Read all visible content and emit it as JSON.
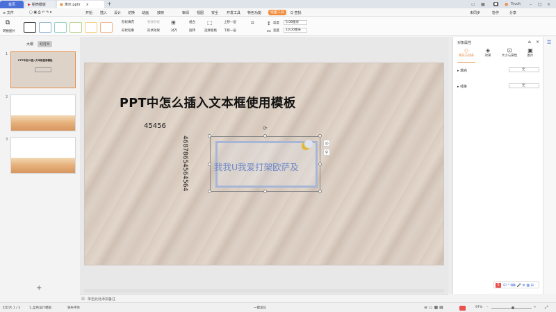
{
  "tabs": {
    "home": "首页",
    "t1": "稻壳模板",
    "t2": "演示.pptx",
    "add": "+"
  },
  "titlebar_right": {
    "workspace": "工作台",
    "user": "Tsvolt"
  },
  "menu": {
    "file": "≡ 文件",
    "items": [
      "开始",
      "插入",
      "设计",
      "切换",
      "动画",
      "放映",
      "审阅",
      "视图",
      "安全",
      "开发工具",
      "特色功能"
    ],
    "active": "绘图工具",
    "search": "Q 查找",
    "right": [
      "未同步",
      "协作",
      "分享"
    ]
  },
  "ribbon": {
    "shape_fill": "形状填充",
    "shape_outline": "形状轮廓",
    "shape_effect": "形状效果",
    "change_shape": "更改形状",
    "arrange": "对齐",
    "rotate": "旋转",
    "select_pane": "选择窗格",
    "up_layer": "上移一层",
    "down_layer": "下移一层",
    "group": "组合",
    "height_label": "高度",
    "height_value": "5.08厘米",
    "width_label": "宽度",
    "width_value": "10.00厘米",
    "convert": "转换图片"
  },
  "left": {
    "tab_outline": "大纲",
    "tab_slides": "幻灯片",
    "slide_numbers": [
      "1",
      "2",
      "3"
    ],
    "thumb1_title": "PPT中怎么插入文本框使用模板",
    "add": "+"
  },
  "slide": {
    "title": "PPT中怎么插入文本框使用模板",
    "num1": "45456",
    "vertical": "46878654564564",
    "textbox": "我我U我爱打架欧萨及"
  },
  "notes": "单击此处添加备注",
  "right_panel": {
    "title": "对象属性",
    "tabs": [
      "填充与线条",
      "效果",
      "大小与属性",
      "图片"
    ],
    "fill_label": "填充",
    "fill_value": "无",
    "line_label": "线条",
    "line_value": "无"
  },
  "status": {
    "slide_info": "幻灯片 1 / 3",
    "theme": "1_蓝色设计模板",
    "font_missing": "缺失字体",
    "beautify": "一键美化",
    "zoom": "97%"
  },
  "colors": {
    "accent": "#f28c3c",
    "home_tab": "#4a6fd8",
    "textbox_text": "#6f89c8"
  }
}
